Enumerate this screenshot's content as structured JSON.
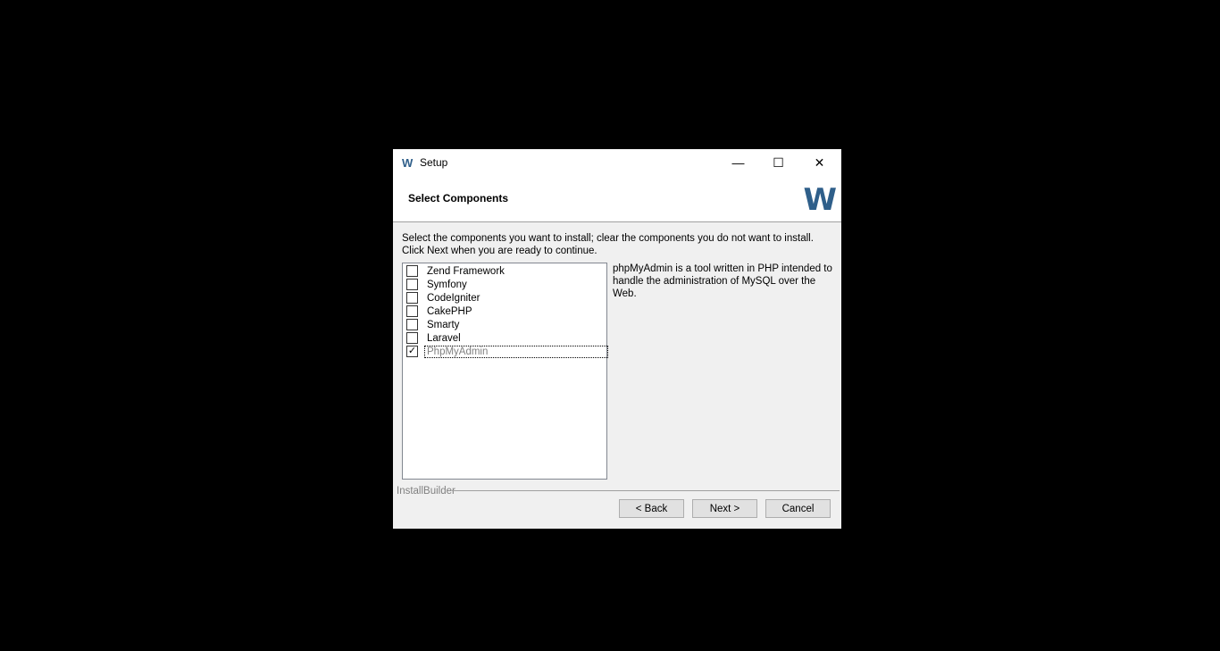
{
  "window": {
    "title": "Setup",
    "title_icon": "W",
    "controls": {
      "minimize": "—",
      "maximize": "☐",
      "close": "✕"
    }
  },
  "header": {
    "title": "Select Components",
    "logo": "W"
  },
  "instructions": "Select the components you want to install; clear the components you do not want to install. Click Next when you are ready to continue.",
  "components": [
    {
      "label": "Zend Framework",
      "checked": false
    },
    {
      "label": "Symfony",
      "checked": false
    },
    {
      "label": "CodeIgniter",
      "checked": false
    },
    {
      "label": "CakePHP",
      "checked": false
    },
    {
      "label": "Smarty",
      "checked": false
    },
    {
      "label": "Laravel",
      "checked": false
    },
    {
      "label": "PhpMyAdmin",
      "checked": true
    }
  ],
  "description": "phpMyAdmin is a tool written in PHP intended to handle the administration of MySQL over the Web.",
  "footer": {
    "brand": "InstallBuilder",
    "back_label": "< Back",
    "next_label": "Next >",
    "cancel_label": "Cancel"
  },
  "colors": {
    "logo": "#2f5f8a",
    "background": "#000000",
    "dialog": "#f0f0f0"
  }
}
